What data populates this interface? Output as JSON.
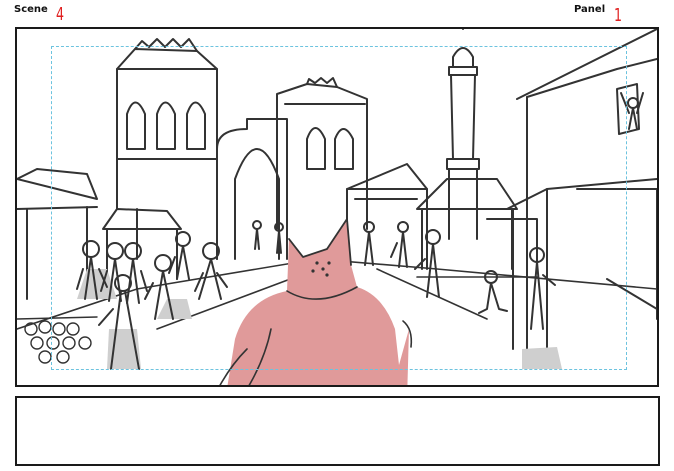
{
  "header": {
    "scene_label": "Scene",
    "scene_number": "4",
    "panel_label": "Panel",
    "panel_number": "1"
  },
  "colors": {
    "sketch_line": "#333333",
    "character_fill": "#e09a9a",
    "shadow_fill": "#cfcfcf",
    "safe_guide": "#6cc3df",
    "annotation_red": "#e02020"
  },
  "notes_text": ""
}
